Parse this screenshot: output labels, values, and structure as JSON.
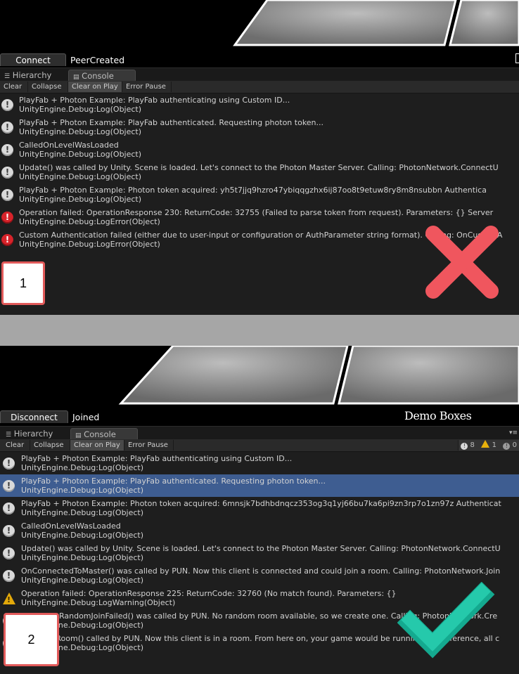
{
  "panel1": {
    "game_buttons": {
      "connect": "Connect"
    },
    "status": "PeerCreated",
    "tabs": {
      "hierarchy": "Hierarchy",
      "console": "Console"
    },
    "toolbar": {
      "clear": "Clear",
      "collapse": "Collapse",
      "clear_on_play": "Clear on Play",
      "error_pause": "Error Pause"
    },
    "logs": [
      {
        "type": "info",
        "line1": "PlayFab + Photon Example: PlayFab authenticating using Custom ID...",
        "line2": "UnityEngine.Debug:Log(Object)"
      },
      {
        "type": "info",
        "line1": "PlayFab + Photon Example: PlayFab authenticated. Requesting photon token...",
        "line2": "UnityEngine.Debug:Log(Object)"
      },
      {
        "type": "info",
        "line1": "CalledOnLevelWasLoaded",
        "line2": "UnityEngine.Debug:Log(Object)"
      },
      {
        "type": "info",
        "line1": "Update() was called by Unity. Scene is loaded. Let's connect to the Photon Master Server. Calling: PhotonNetwork.ConnectU",
        "line2": "UnityEngine.Debug:Log(Object)"
      },
      {
        "type": "info",
        "line1": "PlayFab + Photon Example: Photon token acquired: yh5t7jjq9hzro47ybiqqgzhx6ij87oo8t9etuw8ry8m8nsubbn  Authentica",
        "line2": "UnityEngine.Debug:Log(Object)"
      },
      {
        "type": "error",
        "line1": "Operation failed: OperationResponse 230: ReturnCode: 32755 (Failed to parse token from request). Parameters: {} Server",
        "line2": "UnityEngine.Debug:LogError(Object)"
      },
      {
        "type": "error",
        "line1": "Custom Authentication failed (either due to user-input or configuration or AuthParameter string format). Calling: OnCustomA",
        "line2": "UnityEngine.Debug:LogError(Object)"
      }
    ],
    "label": "1",
    "result_icon": "red-x-icon"
  },
  "panel2": {
    "game_buttons": {
      "disconnect": "Disconnect"
    },
    "status": "Joined",
    "title": "Demo Boxes",
    "tabs": {
      "hierarchy": "Hierarchy",
      "console": "Console"
    },
    "toolbar": {
      "clear": "Clear",
      "collapse": "Collapse",
      "clear_on_play": "Clear on Play",
      "error_pause": "Error Pause"
    },
    "counters": {
      "info": "8",
      "warning": "1",
      "error": "0"
    },
    "logs": [
      {
        "type": "info",
        "selected": false,
        "line1": "PlayFab + Photon Example: PlayFab authenticating using Custom ID...",
        "line2": "UnityEngine.Debug:Log(Object)"
      },
      {
        "type": "info",
        "selected": true,
        "line1": "PlayFab + Photon Example: PlayFab authenticated. Requesting photon token...",
        "line2": "UnityEngine.Debug:Log(Object)"
      },
      {
        "type": "info",
        "selected": false,
        "line1": "PlayFab + Photon Example: Photon token acquired: 6mnsjk7bdhbdnqcz353og3q1yj66bu7ka6pi9zn3rp7o1zn97z  Authenticat",
        "line2": "UnityEngine.Debug:Log(Object)"
      },
      {
        "type": "info",
        "selected": false,
        "line1": "CalledOnLevelWasLoaded",
        "line2": "UnityEngine.Debug:Log(Object)"
      },
      {
        "type": "info",
        "selected": false,
        "line1": "Update() was called by Unity. Scene is loaded. Let's connect to the Photon Master Server. Calling: PhotonNetwork.ConnectU",
        "line2": "UnityEngine.Debug:Log(Object)"
      },
      {
        "type": "info",
        "selected": false,
        "line1": "OnConnectedToMaster() was called by PUN. Now this client is connected and could join a room. Calling: PhotonNetwork.Join",
        "line2": "UnityEngine.Debug:Log(Object)"
      },
      {
        "type": "warning",
        "selected": false,
        "line1": "Operation failed: OperationResponse 225: ReturnCode: 32760 (No match found). Parameters: {}",
        "line2": "UnityEngine.Debug:LogWarning(Object)"
      },
      {
        "type": "info",
        "selected": false,
        "line1": "OnPhotonRandomJoinFailed() was called by PUN. No random room available, so we create one. Calling: PhotonNetwork.Cre",
        "line2": "UnityEngine.Debug:Log(Object)"
      },
      {
        "type": "info",
        "selected": false,
        "line1": "OnJoinedRoom() called by PUN. Now this client is in a room. From here on, your game would be running. For reference, all c",
        "line2": "UnityEngine.Debug:Log(Object)"
      }
    ],
    "label": "2",
    "result_icon": "green-check-icon"
  }
}
